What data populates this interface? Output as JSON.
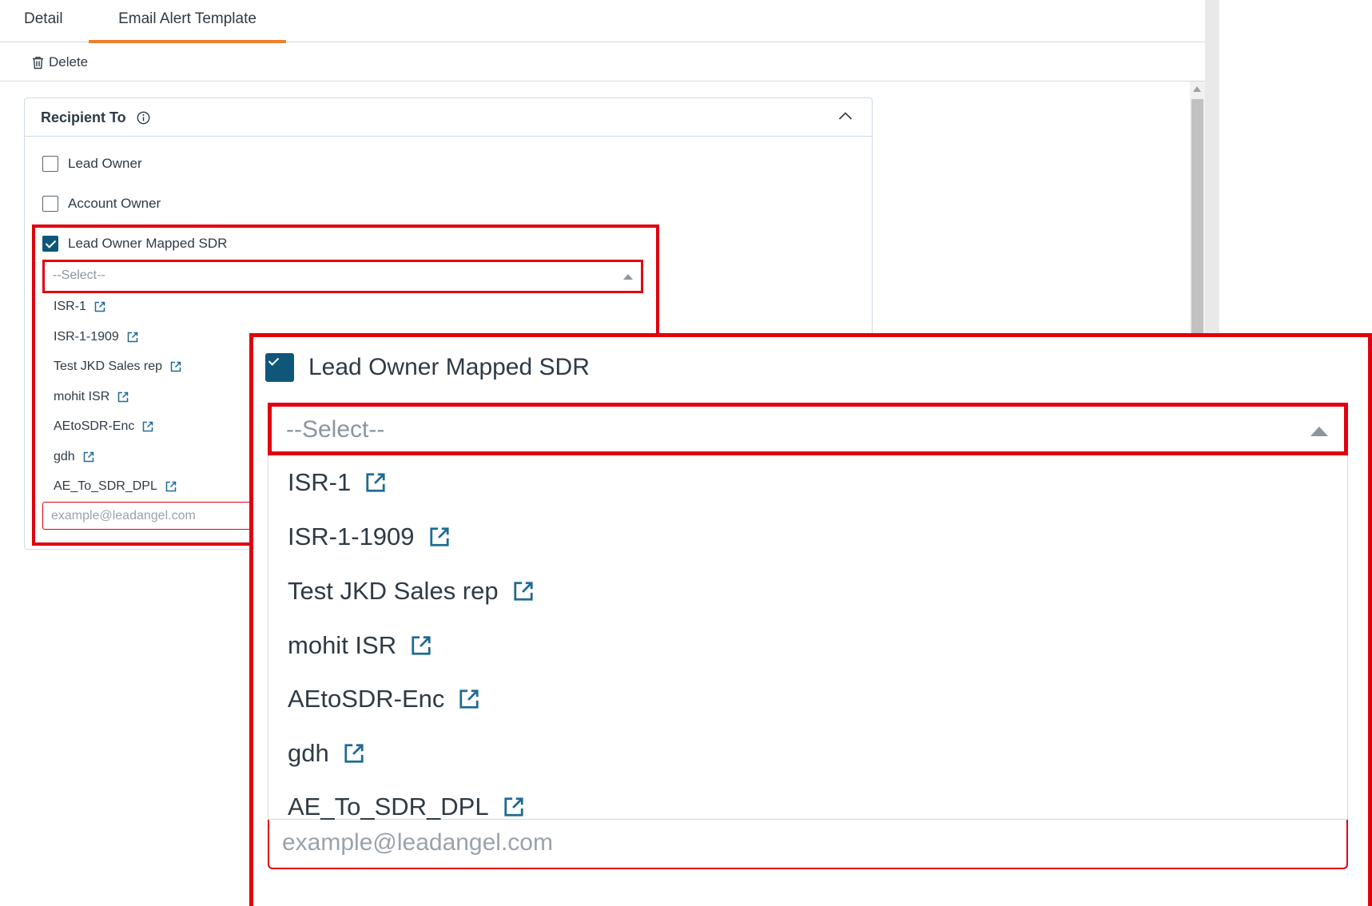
{
  "tabs": [
    {
      "label": "Detail",
      "active": false
    },
    {
      "label": "Email Alert Template",
      "active": true
    }
  ],
  "toolbar": {
    "delete_label": "Delete"
  },
  "panel": {
    "title": "Recipient To",
    "checkboxes": [
      {
        "label": "Lead Owner",
        "checked": false
      },
      {
        "label": "Account Owner",
        "checked": false
      },
      {
        "label": "Lead Owner Mapped SDR",
        "checked": true
      }
    ],
    "select": {
      "placeholder": "--Select--"
    },
    "options": [
      "ISR-1",
      "ISR-1-1909",
      "Test JKD Sales rep",
      "mohit ISR",
      "AEtoSDR-Enc",
      "gdh",
      "AE_To_SDR_DPL"
    ],
    "email_placeholder": "example@leadangel.com"
  },
  "colors": {
    "accent_tab": "#f07d2b",
    "checkbox": "#0f5779",
    "highlight": "#e0000f",
    "link_icon": "#1f6a94"
  },
  "icons": {
    "delete": "trash-icon",
    "info": "info-icon",
    "collapse": "chevron-up-icon",
    "option_link": "external-link-icon",
    "select_caret": "caret-up-icon"
  }
}
